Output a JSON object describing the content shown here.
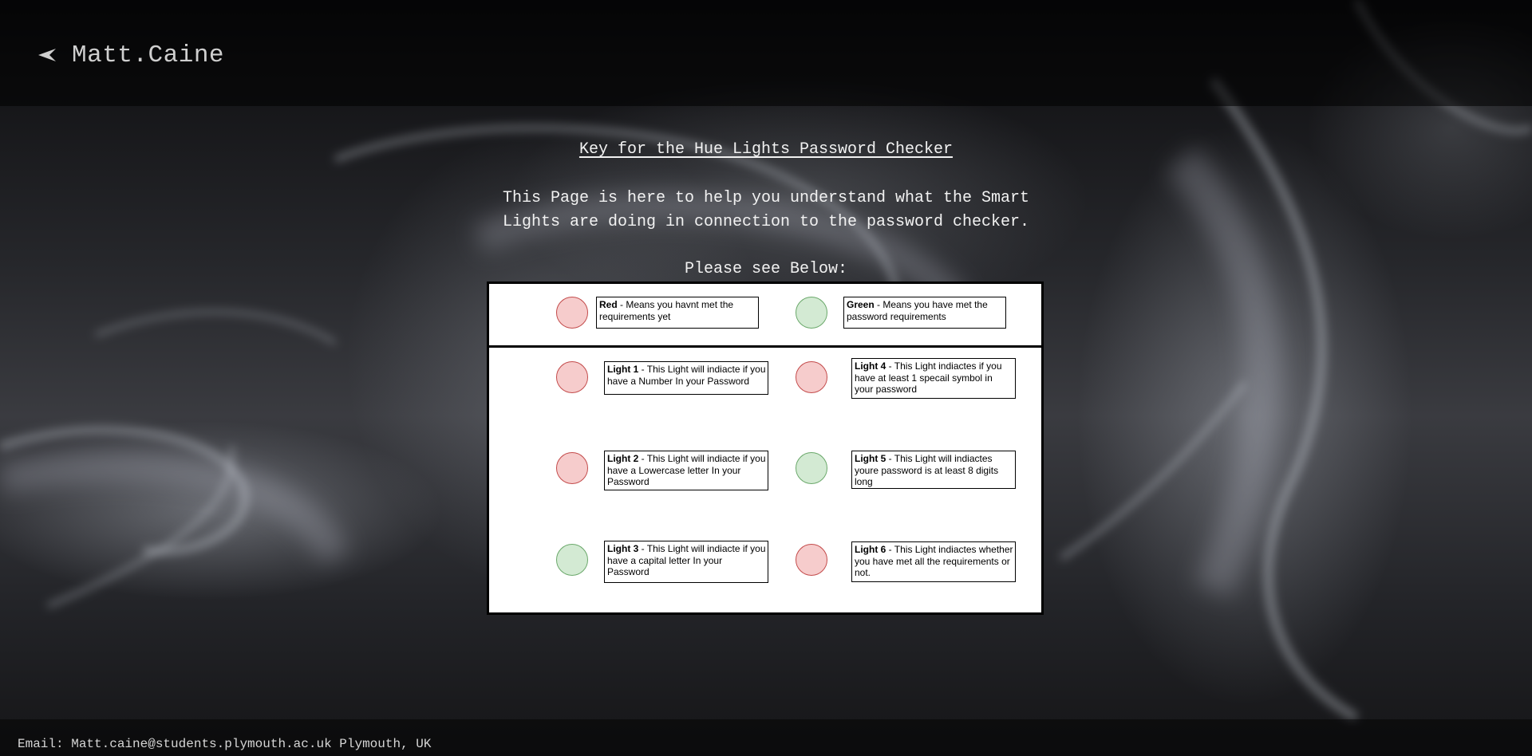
{
  "header": {
    "brand_name": "Matt.Caine",
    "back_icon": "chevron-left-icon"
  },
  "main": {
    "title": "Key for the Hue Lights Password Checker",
    "intro": "This Page is here to help you understand what the Smart Lights are doing in connection to the password checker.",
    "see_below": "Please see Below:"
  },
  "legend": [
    {
      "label": "Red",
      "text": " - Means you havnt met the requirements yet",
      "color": "red"
    },
    {
      "label": "Green",
      "text": " - Means you have met the password requirements",
      "color": "green"
    }
  ],
  "lights": [
    {
      "label": "Light 1",
      "text": " - This Light will indiacte if you have a Number In your Password",
      "color": "red"
    },
    {
      "label": "Light 2",
      "text": " - This Light will indiacte if you have a Lowercase letter In your Password",
      "color": "red"
    },
    {
      "label": "Light 3",
      "text": " - This Light will indiacte if you have a capital letter In your Password",
      "color": "green"
    },
    {
      "label": "Light 4",
      "text": " - This Light indiactes if you have at least 1 specail symbol in your password",
      "color": "red"
    },
    {
      "label": "Light 5",
      "text": " - This Light will indiactes youre password is at least 8 digits long",
      "color": "green"
    },
    {
      "label": "Light 6",
      "text": " - This Light indiactes whether you have met all the requirements or not.",
      "color": "red"
    }
  ],
  "colors": {
    "red_fill": "#f6cccc",
    "red_border": "#c34a4a",
    "green_fill": "#d3ead3",
    "green_border": "#6aa86a"
  },
  "footer": {
    "contact": "Email: Matt.caine@students.plymouth.ac.uk Plymouth, UK"
  }
}
